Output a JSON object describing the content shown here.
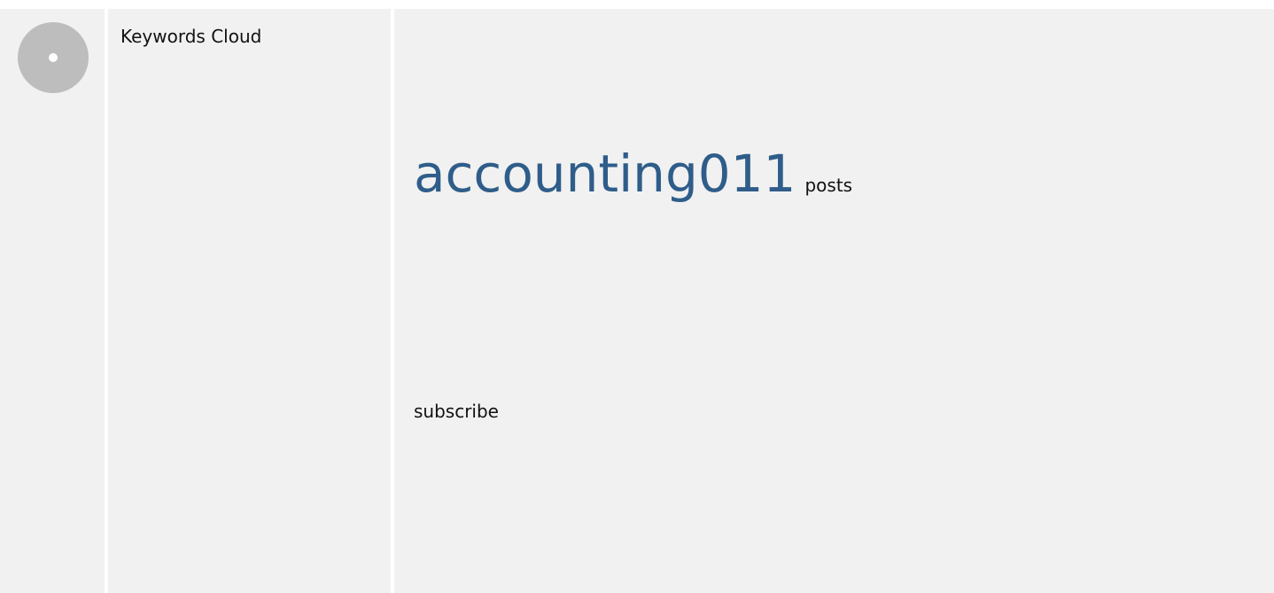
{
  "section": {
    "title": "Keywords Cloud",
    "status_icon": "neutral-circle-icon",
    "status_color": "#bdbdbd"
  },
  "cloud": {
    "keyword_color": "#2f5d8a",
    "lines": [
      "",
      "",
      "",
      "",
      ""
    ],
    "featured_keyword": "accounting011",
    "featured_keyword_suffix": "posts",
    "lines_after_featured": [
      "",
      "",
      "",
      "",
      "",
      " ",
      "",
      ""
    ],
    "subscribe_label": "subscribe",
    "lines_final": [
      "",
      "",
      ""
    ]
  }
}
